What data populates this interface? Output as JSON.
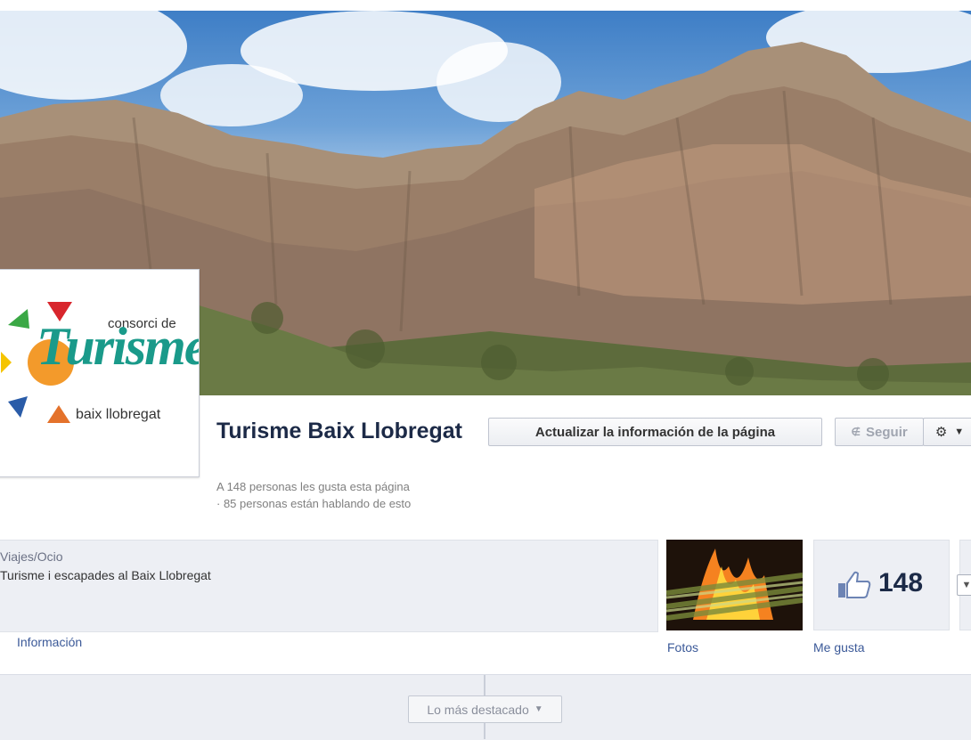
{
  "page": {
    "name": "Turisme Baix Llobregat",
    "likes_stat": "A 148 personas les gusta esta página",
    "talking_stat": "· 85 personas están hablando de esto"
  },
  "logo": {
    "top_text": "consorci de",
    "main_text": "Turisme",
    "bottom_text": "baix llobregat"
  },
  "actions": {
    "update_label": "Actualizar la información de la página",
    "follow_label": "Seguir",
    "gear_icon": "gear-icon"
  },
  "info": {
    "category": "Viajes/Ocio",
    "description": "Turisme i escapades al Baix Llobregat",
    "link_label": "Información"
  },
  "apps": {
    "photos_label": "Fotos",
    "likes_count": "148",
    "likes_label": "Me gusta"
  },
  "timeline": {
    "highlights_label": "Lo más destacado"
  },
  "colors": {
    "link": "#3b5998",
    "title": "#1c2a47",
    "logo_teal": "#1a9a8a"
  }
}
